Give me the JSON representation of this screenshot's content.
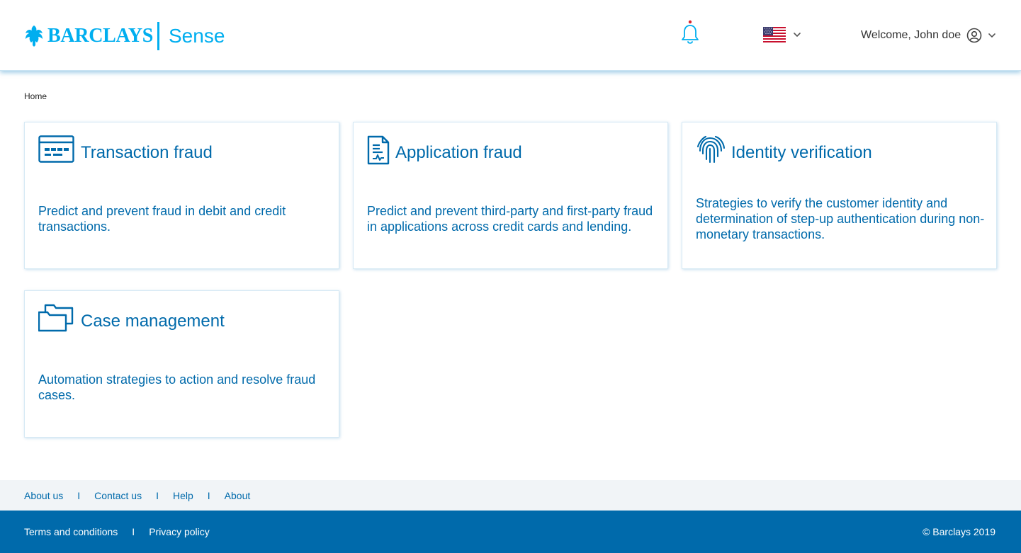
{
  "header": {
    "logo_text": "BARCLAYS",
    "product_name": "Sense",
    "welcome_text": "Welcome, John doe",
    "notification_icon": "bell-icon",
    "language_flag": "us-flag-icon"
  },
  "breadcrumb": {
    "home": "Home"
  },
  "cards": [
    {
      "title": "Transaction fraud",
      "description": "Predict and prevent fraud in debit and credit transactions.",
      "icon": "credit-card-icon"
    },
    {
      "title": "Application fraud",
      "description": "Predict and prevent third-party and first-party fraud in applications across credit cards and lending.",
      "icon": "document-icon"
    },
    {
      "title": "Identity verification",
      "description": "Strategies to verify the customer identity and determination of step-up authentication during non-monetary transactions.",
      "icon": "fingerprint-icon"
    },
    {
      "title": "Case management",
      "description": "Automation strategies to action and resolve fraud cases.",
      "icon": "folders-icon"
    }
  ],
  "footer": {
    "links": [
      "About us",
      "Contact us",
      "Help",
      "About"
    ],
    "separator": "I",
    "legal_links": [
      "Terms and conditions",
      "Privacy policy"
    ],
    "copyright": "© Barclays 2019"
  },
  "colors": {
    "brand_cyan": "#00aeef",
    "brand_blue": "#006aab",
    "footer_light": "#f1f4f7",
    "notification_dot": "#d9272e"
  }
}
